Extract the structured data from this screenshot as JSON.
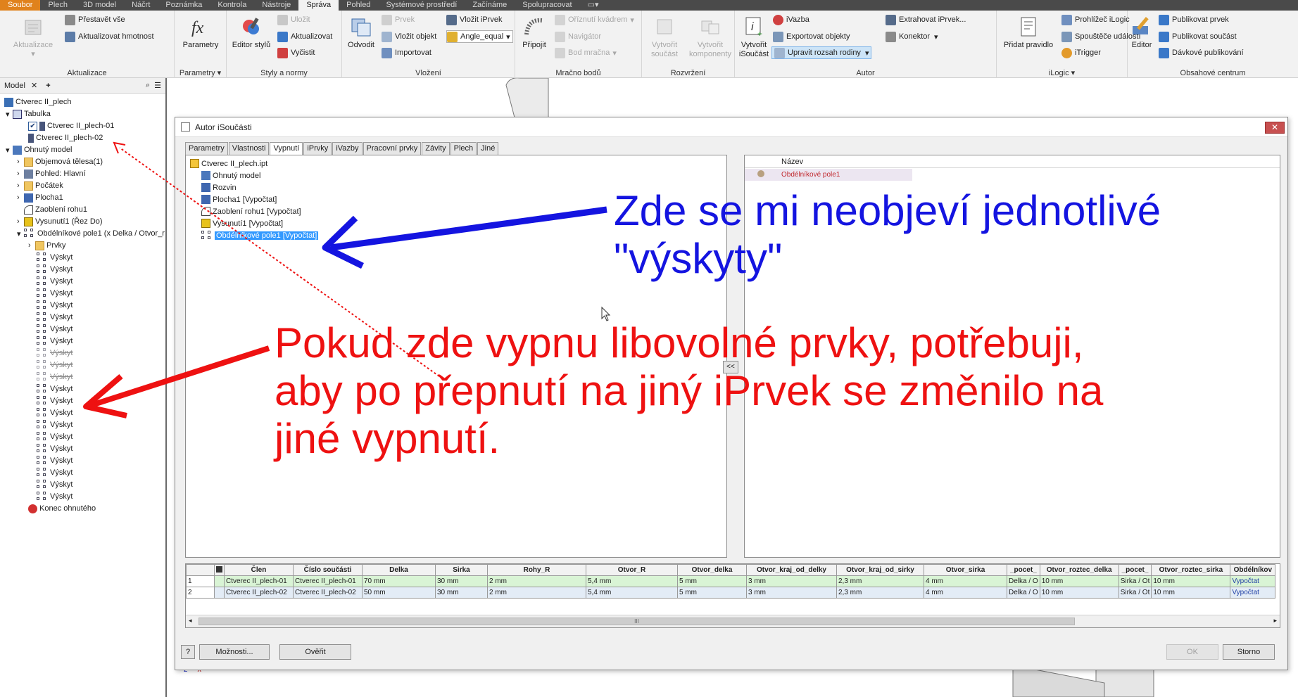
{
  "menu": {
    "tabs": [
      "Soubor",
      "Plech",
      "3D model",
      "Náčrt",
      "Poznámka",
      "Kontrola",
      "Nástroje",
      "Správa",
      "Pohled",
      "Systémové prostředí",
      "Začínáme",
      "Spolupracovat"
    ]
  },
  "ribbon": {
    "aktualizace": {
      "title": "Aktualizace",
      "big": "Aktualizace",
      "s1": "Přestavět vše",
      "s2": "Aktualizovat hmotnost"
    },
    "parametry": {
      "title": "Parametry",
      "big": "Parametry"
    },
    "styly": {
      "title": "Styly a normy",
      "big": "Editor stylů",
      "s1": "Uložit",
      "s2": "Aktualizovat",
      "s3": "Vyčistit"
    },
    "vlozeni": {
      "title": "Vložení",
      "big": "Odvodit",
      "s1": "Prvek",
      "s2": "Vložit objekt",
      "s3": "Importovat",
      "s4": "Vložit iPrvek",
      "dropdown": "Angle_equal"
    },
    "mracno": {
      "title": "Mračno bodů",
      "big": "Připojit",
      "s1": "Oříznutí kvádrem",
      "s2": "Navigátor",
      "s3": "Bod mračna"
    },
    "rozvrzeni": {
      "title": "Rozvržení",
      "big1": "Vytvořit součást",
      "big2": "Vytvořit komponenty"
    },
    "autor": {
      "title": "Autor",
      "big": "Vytvořit iSoučást",
      "s1": "iVazba",
      "s2": "Exportovat objekty",
      "s3": "Upravit rozsah rodiny",
      "s4": "Extrahovat iPrvek...",
      "s5": "Konektor"
    },
    "ilogic": {
      "title": "iLogic",
      "big": "Přidat pravidlo",
      "s1": "Prohlížeč iLogic",
      "s2": "Spouštěče událostí",
      "s3": "iTrigger"
    },
    "obsah": {
      "title": "Obsahové centrum",
      "big": "Editor",
      "s1": "Publikovat prvek",
      "s2": "Publikovat součást",
      "s3": "Dávkové publikování"
    }
  },
  "browser": {
    "tab_label": "Model",
    "root": "Ctverec II_plech",
    "table": "Tabulka",
    "member1": "Ctverec II_plech-01",
    "member2": "Ctverec II_plech-02",
    "folded": "Ohnutý model",
    "bodies": "Objemová tělesa(1)",
    "view": "Pohled: Hlavní",
    "origin": "Počátek",
    "face": "Plocha1",
    "corner": "Zaoblení rohu1",
    "extrude": "Vysunutí1 (Řez Do)",
    "pattern": "Obdélníkové pole1 (x Delka / Otvor_r",
    "features": "Prvky",
    "occurrence": "Výskyt",
    "end": "Konec ohnutého"
  },
  "dialog": {
    "title": "Autor iSoučásti",
    "tabs": [
      "Parametry",
      "Vlastnosti",
      "Vypnutí",
      "iPrvky",
      "iVazby",
      "Pracovní prvky",
      "Závity",
      "Plech",
      "Jiné"
    ],
    "tree": {
      "file": "Ctverec II_plech.ipt",
      "folded": "Ohnutý model",
      "flat": "Rozvin",
      "face": "Plocha1 [Vypočtat]",
      "corner": "Zaoblení rohu1 [Vypočtat]",
      "extrude": "Vysunutí1 [Vypočtat]",
      "pattern": "Obdélníkové pole1 [Vypočtat]"
    },
    "collapse_button": "<<",
    "right_header": "Název",
    "right_item": "Obdélníkové pole1",
    "grid": {
      "headers": [
        "Člen",
        "Číslo součásti",
        "Delka",
        "Sirka",
        "Rohy_R",
        "Otvor_R",
        "Otvor_delka",
        "Otvor_kraj_od_delky",
        "Otvor_kraj_od_sirky",
        "Otvor_sirka",
        "_pocet_",
        "Otvor_roztec_delka",
        "_pocet_",
        "Otvor_roztec_sirka",
        "Obdélníkov"
      ],
      "rows": [
        {
          "n": "1",
          "cells": [
            "Ctverec II_plech-01",
            "Ctverec II_plech-01",
            "70 mm",
            "30 mm",
            "2 mm",
            "5,4 mm",
            "5 mm",
            "3 mm",
            "2,3 mm",
            "4 mm",
            "Delka / O",
            "10 mm",
            "Sirka / Ot",
            "10 mm",
            "Vypočtat"
          ]
        },
        {
          "n": "2",
          "cells": [
            "Ctverec II_plech-02",
            "Ctverec II_plech-02",
            "50 mm",
            "30 mm",
            "2 mm",
            "5,4 mm",
            "5 mm",
            "3 mm",
            "2,3 mm",
            "4 mm",
            "Delka / O",
            "10 mm",
            "Sirka / Ot",
            "10 mm",
            "Vypočtat"
          ]
        }
      ]
    },
    "scroll_grip": "III",
    "buttons": {
      "options": "Možnosti...",
      "verify": "Ověřit",
      "ok": "OK",
      "cancel": "Storno"
    }
  },
  "annotations": {
    "blue_line1": "Zde se mi neobjeví jednotlivé",
    "blue_line2": "\"výskyty\"",
    "red_line1": "Pokud zde vypnu libovolné prvky, potřebuji,",
    "red_line2": "aby po přepnutí na jiný iPrvek se změnilo na",
    "red_line3": "jiné vypnutí.",
    "blue_color": "#1414e0",
    "red_color": "#ee1111"
  }
}
